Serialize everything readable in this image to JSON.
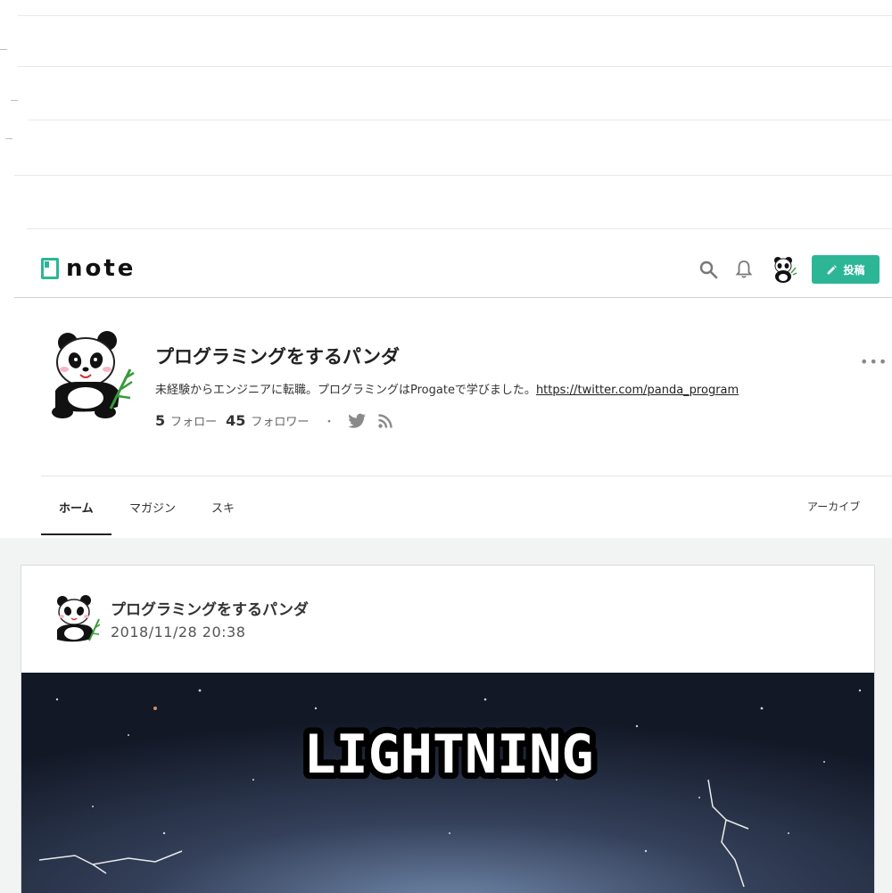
{
  "header": {
    "logo_text": "note",
    "post_button_label": "投稿",
    "icons": [
      "search-icon",
      "bell-icon",
      "avatar",
      "pencil-icon"
    ],
    "accent_color": "#2cb696"
  },
  "profile": {
    "name": "プログラミングをするパンダ",
    "bio": "未経験からエンジニアに転職。プログラミングはProgateで学びました。",
    "bio_link": "https://twitter.com/panda_program",
    "follow_count": "5",
    "follow_label": "フォロー",
    "follower_count": "45",
    "follower_label": "フォロワー",
    "separator": "・",
    "more_label": "•••"
  },
  "tabs": {
    "home": "ホーム",
    "magazine": "マガジン",
    "suki": "スキ",
    "archive": "アーカイブ"
  },
  "post": {
    "author": "プログラミングをするパンダ",
    "date": "2018/11/28 20:38",
    "image_title": "LIGHTNING"
  }
}
